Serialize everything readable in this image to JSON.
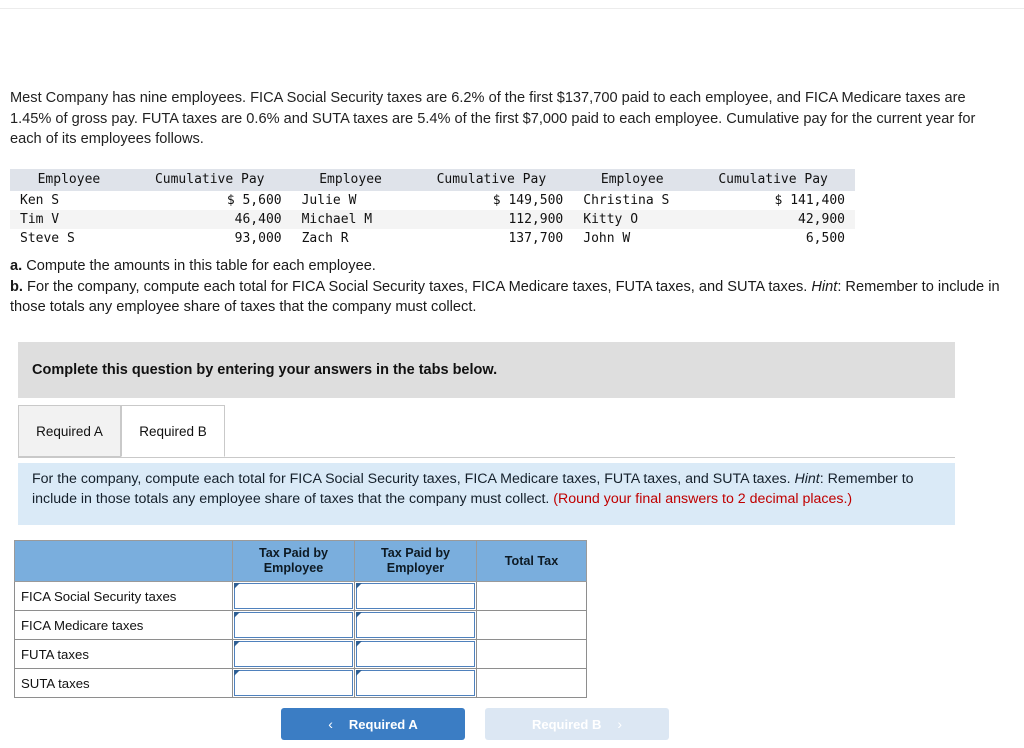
{
  "problem": {
    "statement": "Mest Company has nine employees. FICA Social Security taxes are 6.2% of the first $137,700 paid to each employee, and FICA Medicare taxes are 1.45% of gross pay. FUTA taxes are 0.6% and SUTA taxes are 5.4% of the first $7,000 paid to each employee. Cumulative pay for the current year for each of its employees follows."
  },
  "employee_table": {
    "headers": [
      "Employee",
      "Cumulative Pay",
      "Employee",
      "Cumulative Pay",
      "Employee",
      "Cumulative Pay"
    ],
    "rows": [
      [
        "Ken S",
        "$ 5,600",
        "Julie W",
        "$ 149,500",
        "Christina S",
        "$ 141,400"
      ],
      [
        "Tim V",
        "46,400",
        "Michael M",
        "112,900",
        "Kitty O",
        "42,900"
      ],
      [
        "Steve S",
        "93,000",
        "Zach R",
        "137,700",
        "John W",
        "6,500"
      ]
    ]
  },
  "requirements": {
    "a_marker": "a.",
    "a_text": " Compute the amounts in this table for each employee.",
    "b_marker": "b.",
    "b_text": " For the company, compute each total for FICA Social Security taxes, FICA Medicare taxes, FUTA taxes, and SUTA taxes. ",
    "b_hint_label": "Hint",
    "b_hint_tail": ": Remember to include in those totals any employee share of taxes that the company must collect."
  },
  "banner": {
    "text": "Complete this question by entering your answers in the tabs below."
  },
  "tabs": [
    {
      "label": "Required A",
      "active": false
    },
    {
      "label": "Required B",
      "active": true
    }
  ],
  "instruction_panel": {
    "main_text": "For the company, compute each total for FICA Social Security taxes, FICA Medicare taxes, FUTA taxes, and SUTA taxes. ",
    "hint_label": "Hint",
    "hint_tail": ": Remember to include in those totals any employee share of taxes that the company must collect. ",
    "rounding_note": "(Round your final answers to 2 decimal places.)"
  },
  "answer_table": {
    "corner_header": "",
    "headers": [
      "Tax Paid by Employee",
      "Tax Paid by Employer",
      "Total Tax"
    ],
    "header_lines": [
      [
        "Tax Paid by",
        "Employee"
      ],
      [
        "Tax Paid by",
        "Employer"
      ],
      [
        "Total Tax",
        ""
      ]
    ],
    "rows": [
      {
        "label": "FICA Social Security taxes",
        "employee": "",
        "employer": "",
        "total": ""
      },
      {
        "label": "FICA Medicare taxes",
        "employee": "",
        "employer": "",
        "total": ""
      },
      {
        "label": "FUTA taxes",
        "employee": "",
        "employer": "",
        "total": ""
      },
      {
        "label": "SUTA taxes",
        "employee": "",
        "employer": "",
        "total": ""
      }
    ]
  },
  "nav": {
    "prev_label": "Required A",
    "prev_chevron": "‹",
    "next_label": "Required B",
    "next_chevron": "›"
  },
  "colors": {
    "header_blue": "#7aaedd",
    "input_border_blue": "#4f81bd",
    "panel_blue": "#daeaf7",
    "banner_gray": "#dedede",
    "button_blue": "#3b7dc4",
    "button_disabled": "#dce7f3",
    "accent_red": "#c00000"
  }
}
